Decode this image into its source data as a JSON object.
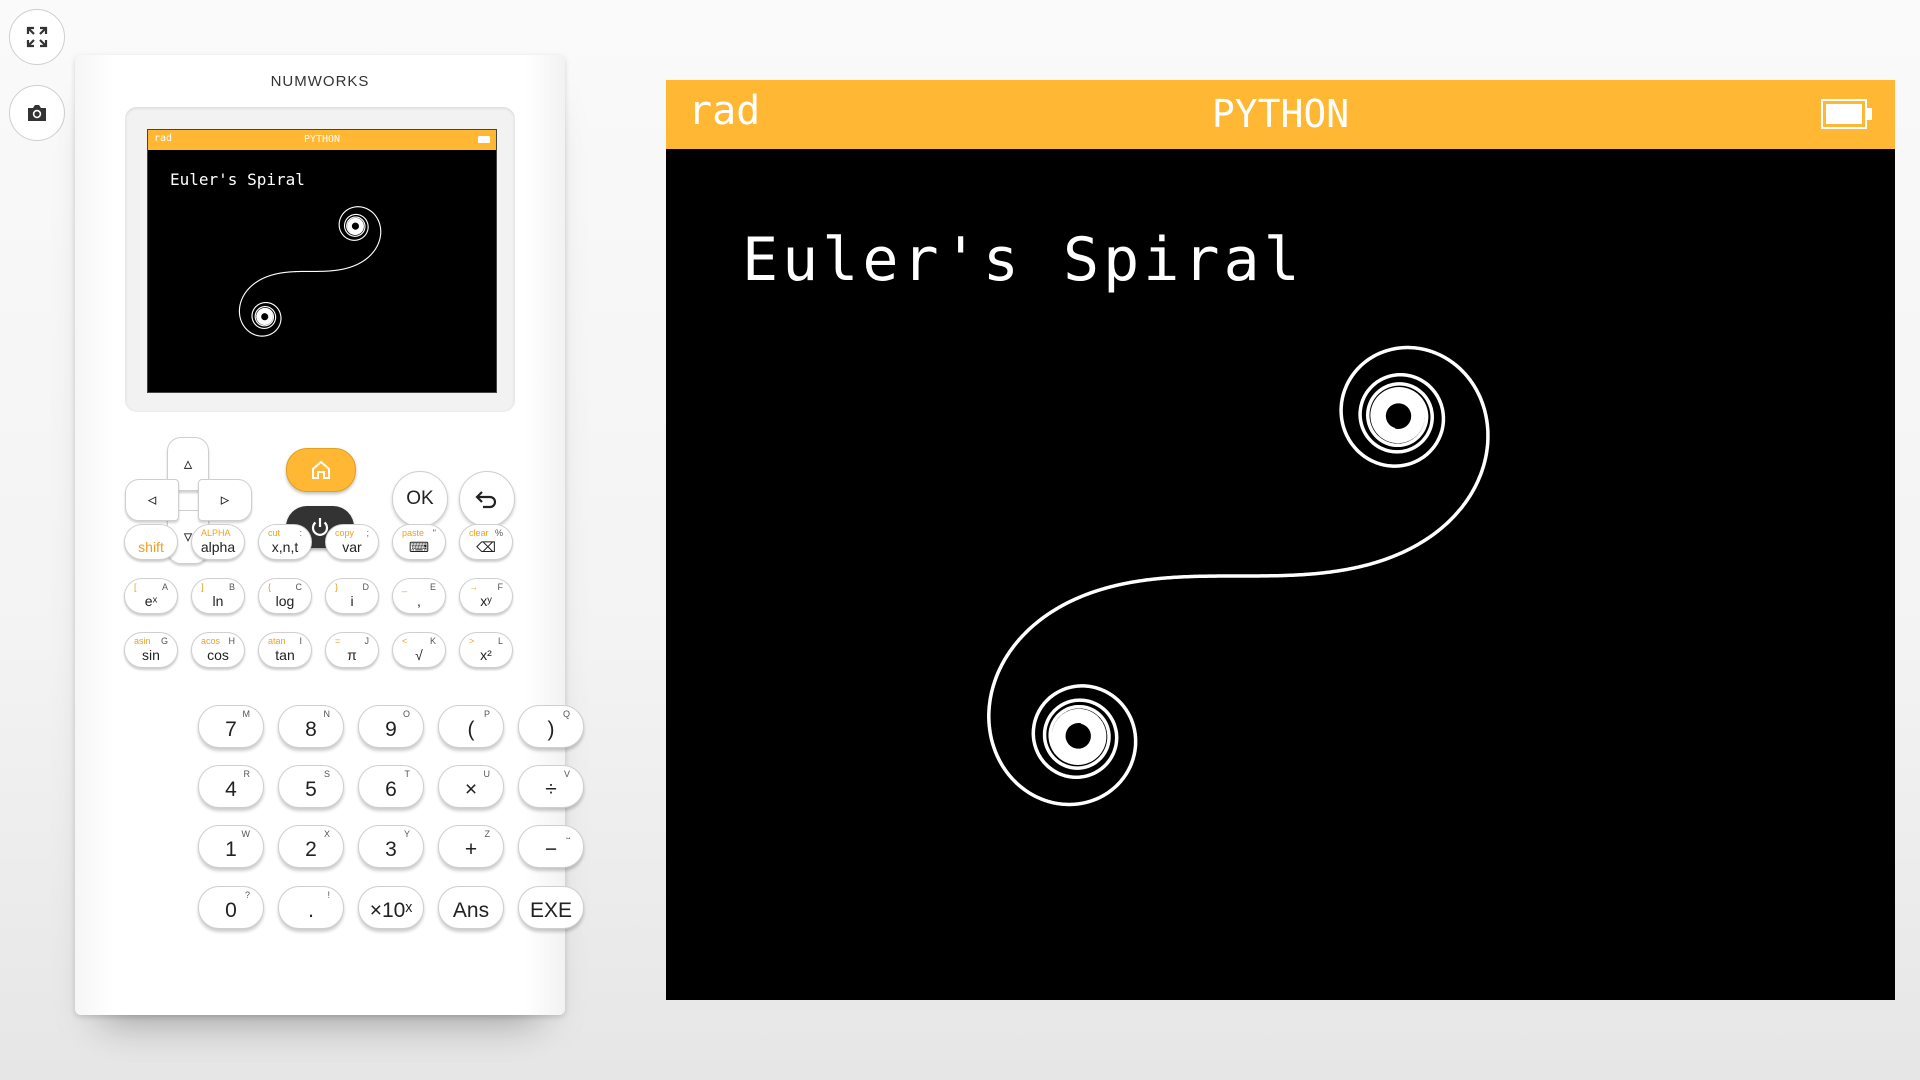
{
  "toolbar": {
    "fullscreen_icon": "fullscreen-icon",
    "screenshot_icon": "camera-icon"
  },
  "calculator": {
    "brand": "NUMWORKS",
    "screen": {
      "angle_mode": "rad",
      "app_title": "PYTHON",
      "text": "Euler's Spiral"
    },
    "colors": {
      "accent": "#ffb734",
      "screen_bg": "#000000",
      "dark_key": "#333333"
    },
    "nav": {
      "up": "▵",
      "down": "▿",
      "left": "◃",
      "right": "▹",
      "ok": "OK",
      "home_icon": "home-icon",
      "power_icon": "power-icon",
      "back_icon": "back-arrow-icon"
    },
    "small_keys": [
      {
        "main": "shift",
        "sec": "",
        "alpha": ""
      },
      {
        "main": "alpha",
        "sec": "ALPHA",
        "alpha": ""
      },
      {
        "main": "x,n,t",
        "sec": "cut",
        "alpha": ":"
      },
      {
        "main": "var",
        "sec": "copy",
        "alpha": ";"
      },
      {
        "main": "⌨",
        "sec": "paste",
        "alpha": "\""
      },
      {
        "main": "⌫",
        "sec": "clear",
        "alpha": "%"
      },
      {
        "main": "eˣ",
        "sec": "[",
        "alpha": "A"
      },
      {
        "main": "ln",
        "sec": "]",
        "alpha": "B"
      },
      {
        "main": "log",
        "sec": "{",
        "alpha": "C"
      },
      {
        "main": "i",
        "sec": "}",
        "alpha": "D"
      },
      {
        "main": ",",
        "sec": "_",
        "alpha": "E"
      },
      {
        "main": "xʸ",
        "sec": "→",
        "alpha": "F"
      },
      {
        "main": "sin",
        "sec": "asin",
        "alpha": "G"
      },
      {
        "main": "cos",
        "sec": "acos",
        "alpha": "H"
      },
      {
        "main": "tan",
        "sec": "atan",
        "alpha": "I"
      },
      {
        "main": "π",
        "sec": "=",
        "alpha": "J"
      },
      {
        "main": "√",
        "sec": "<",
        "alpha": "K"
      },
      {
        "main": "x²",
        "sec": ">",
        "alpha": "L"
      }
    ],
    "big_keys": [
      {
        "main": "7",
        "alpha": "M"
      },
      {
        "main": "8",
        "alpha": "N"
      },
      {
        "main": "9",
        "alpha": "O"
      },
      {
        "main": "(",
        "alpha": "P"
      },
      {
        "main": ")",
        "alpha": "Q"
      },
      {
        "main": "4",
        "alpha": "R"
      },
      {
        "main": "5",
        "alpha": "S"
      },
      {
        "main": "6",
        "alpha": "T"
      },
      {
        "main": "×",
        "alpha": "U"
      },
      {
        "main": "÷",
        "alpha": "V"
      },
      {
        "main": "1",
        "alpha": "W"
      },
      {
        "main": "2",
        "alpha": "X"
      },
      {
        "main": "3",
        "alpha": "Y"
      },
      {
        "main": "+",
        "alpha": "Z"
      },
      {
        "main": "−",
        "alpha": "⎵"
      },
      {
        "main": "0",
        "alpha": "?"
      },
      {
        "main": ".",
        "alpha": "!"
      },
      {
        "main": "×10ˣ",
        "alpha": ""
      },
      {
        "main": "Ans",
        "alpha": ""
      },
      {
        "main": "EXE",
        "alpha": ""
      }
    ]
  },
  "big_screen": {
    "angle_mode": "rad",
    "app_title": "PYTHON",
    "text": "Euler's Spiral",
    "battery_icon": "battery-icon"
  }
}
